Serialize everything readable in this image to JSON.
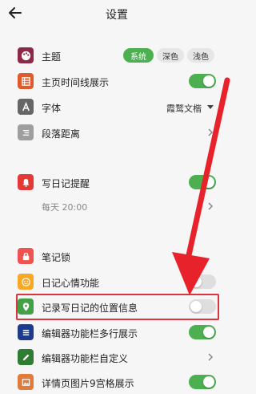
{
  "header": {
    "title": "设置"
  },
  "items": {
    "theme": {
      "label": "主题",
      "options": [
        "系统",
        "深色",
        "浅色"
      ],
      "selected": "系统"
    },
    "timeline": {
      "label": "主页时间线展示",
      "enabled": true
    },
    "font": {
      "label": "字体",
      "value": "霞鹜文楷"
    },
    "paragraph": {
      "label": "段落距离"
    },
    "reminder": {
      "label": "写日记提醒",
      "enabled": true,
      "schedule": "每天  20:00"
    },
    "lock": {
      "label": "笔记锁"
    },
    "mood": {
      "label": "日记心情功能",
      "enabled": false
    },
    "location": {
      "label": "记录写日记的位置信息",
      "enabled": false
    },
    "toolbar_multiline": {
      "label": "编辑器功能栏多行展示",
      "enabled": true
    },
    "toolbar_custom": {
      "label": "编辑器功能栏自定义"
    },
    "grid": {
      "label": "详情页图片9宫格展示",
      "enabled": true
    }
  },
  "colors": {
    "accent": "#4caf50",
    "theme_icon": "#8e2846",
    "timeline_icon": "#e05a2b",
    "font_icon": "#666666",
    "paragraph_icon": "#9e9e9e",
    "reminder_icon": "#e53935",
    "lock_icon": "#ef5350",
    "mood_icon": "#f9a825",
    "location_icon": "#43a047",
    "toolbar_icon": "#1e3a8a",
    "custom_icon": "#2e7d32",
    "grid_icon": "#e07b39",
    "annotation": "#d9363e"
  },
  "icons": {
    "back": "arrow-left-icon",
    "theme": "palette-icon",
    "timeline": "list-icon",
    "font": "font-a-icon",
    "paragraph": "paragraph-lines-icon",
    "reminder": "bell-icon",
    "lock": "lock-icon",
    "mood": "smiley-icon",
    "location": "location-pin-icon",
    "toolbar": "menu-lines-icon",
    "custom": "pencil-icon",
    "grid": "image-icon"
  }
}
